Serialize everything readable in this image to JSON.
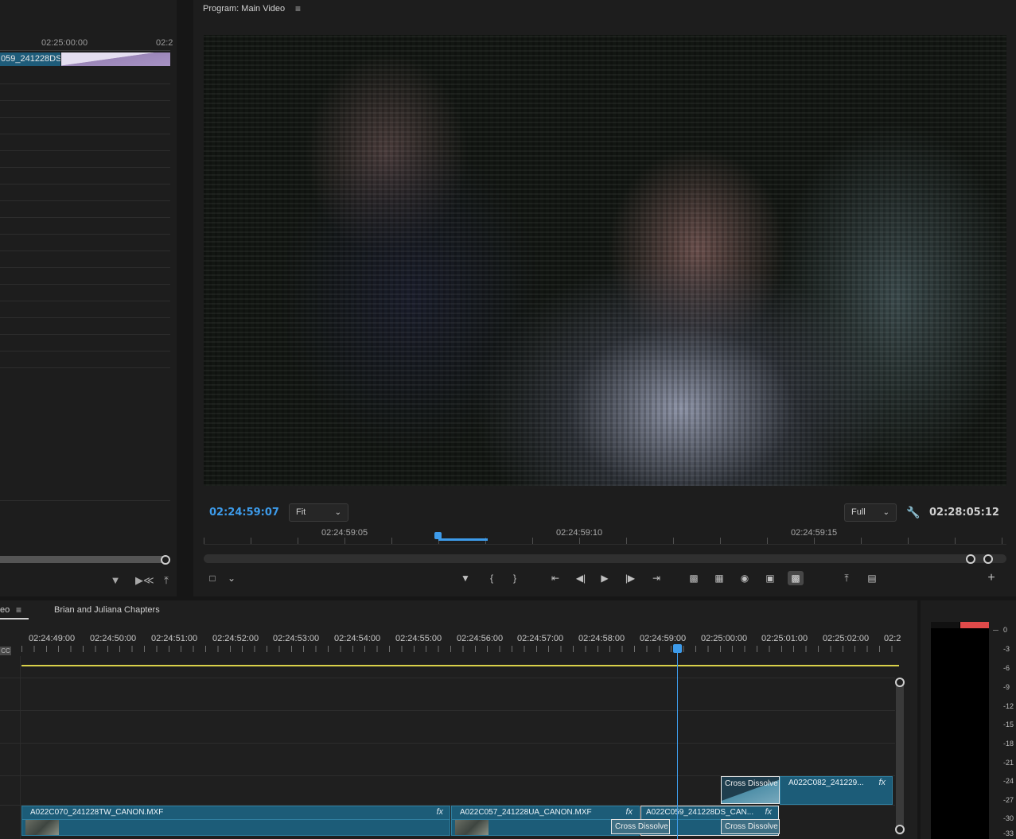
{
  "source_panel": {
    "ruler_timecodes": [
      "02:25:00:00",
      "02:2"
    ],
    "clip_name": "059_241228DS"
  },
  "program": {
    "title": "Program: Main Video",
    "menu_glyph": "≡",
    "current_timecode": "02:24:59:07",
    "duration_timecode": "02:28:05:12",
    "zoom_value": "Fit",
    "quality_value": "Full",
    "mini_ruler_timecodes": [
      "02:24:59:05",
      "02:24:59:10",
      "02:24:59:15"
    ]
  },
  "timeline": {
    "tabs": [
      "eo",
      "Brian and Juliana Chapters"
    ],
    "tab_menu_glyph": "≡",
    "cc_badge": "CC",
    "ruler_timecodes": [
      "02:24:49:00",
      "02:24:50:00",
      "02:24:51:00",
      "02:24:52:00",
      "02:24:53:00",
      "02:24:54:00",
      "02:24:55:00",
      "02:24:56:00",
      "02:24:57:00",
      "02:24:58:00",
      "02:24:59:00",
      "02:25:00:00",
      "02:25:01:00",
      "02:25:02:00",
      "02:2"
    ],
    "clips": {
      "v1_a": "A022C070_241228TW_CANON.MXF",
      "v1_b": "A022C057_241228UA_CANON.MXF",
      "v1_c": "A022C059_241228DS_CAN...",
      "v2_a": "A022C082_241229..."
    },
    "fx_label": "fx",
    "transitions": {
      "v2": "Cross Dissolve",
      "v1_left": "Cross Dissolve",
      "v1_right": "Cross Dissolve"
    }
  },
  "meters": {
    "db_scale": [
      "0",
      "-3",
      "-6",
      "-9",
      "-12",
      "-15",
      "-18",
      "-21",
      "-24",
      "-27",
      "-30",
      "-33"
    ]
  },
  "colors": {
    "accent_blue": "#3d9bea",
    "clip_teal": "#1c5c78",
    "work_area_yellow": "#d9d14a",
    "peak_red": "#e04a4a"
  }
}
